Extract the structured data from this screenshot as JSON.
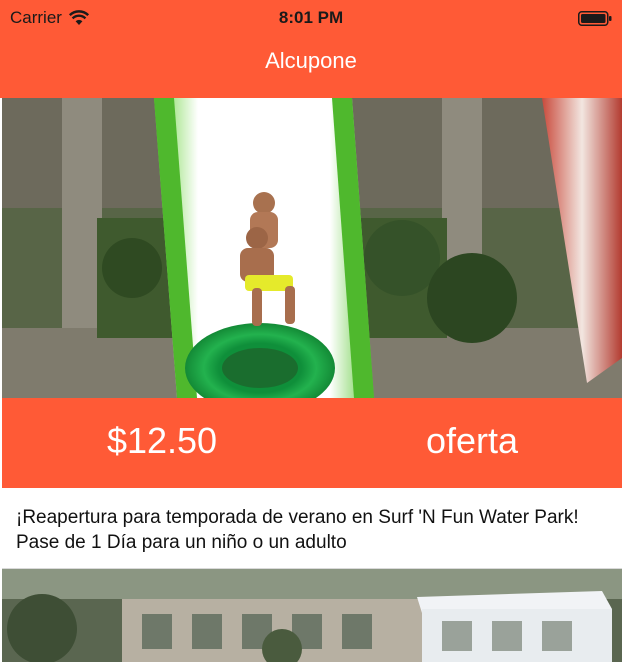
{
  "status_bar": {
    "carrier": "Carrier",
    "time": "8:01 PM",
    "icons": [
      "wifi-icon",
      "battery-icon"
    ]
  },
  "nav": {
    "title": "Alcupone"
  },
  "theme": {
    "accent": "#ff5a36",
    "on_accent_text": "#ffffff"
  },
  "deals": [
    {
      "image_subject": "water-slide-photo",
      "price": "$12.50",
      "tag": "oferta",
      "description": "¡Reapertura para temporada de verano en Surf 'N Fun Water Park! Pase de 1 Día para un niño o un adulto"
    },
    {
      "image_subject": "resort-pool-photo"
    }
  ]
}
